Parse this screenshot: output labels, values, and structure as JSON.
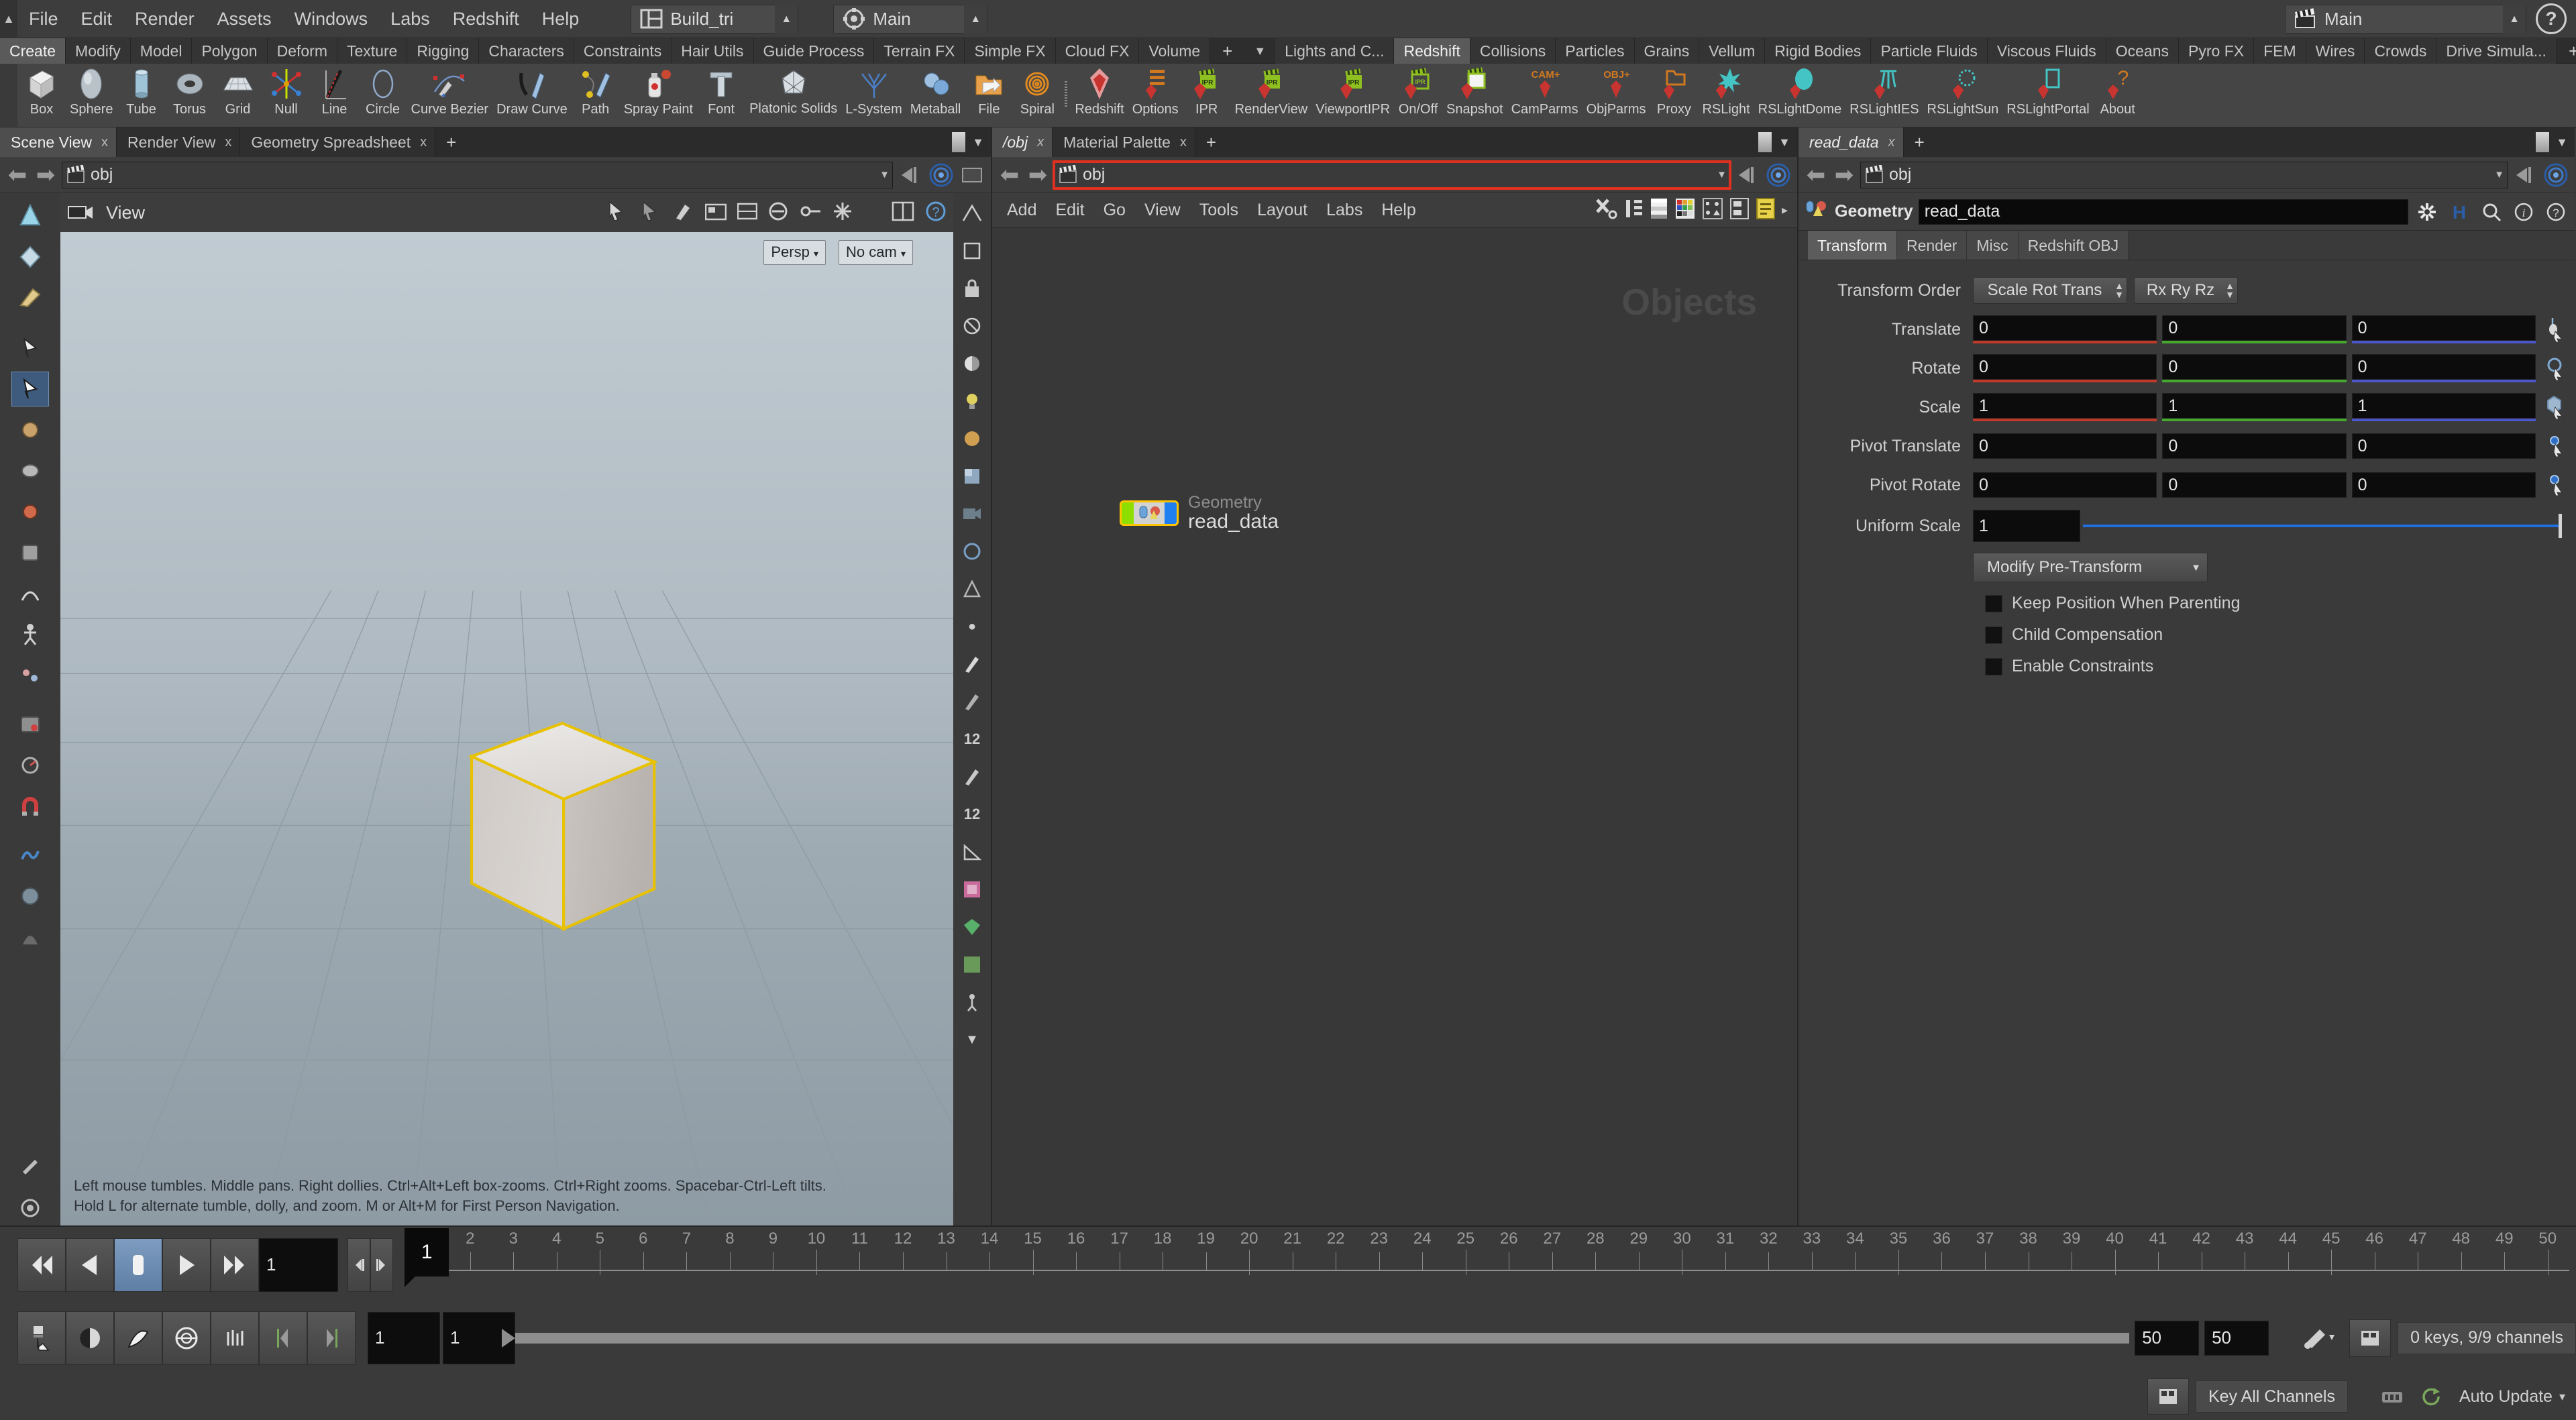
{
  "app": {
    "menus": [
      "File",
      "Edit",
      "Render",
      "Assets",
      "Windows",
      "Labs",
      "Redshift",
      "Help"
    ],
    "desktop_selector": {
      "label": "Build_tri",
      "icon": "layout-panes-icon"
    },
    "viewport_selector": {
      "label": "Main",
      "icon": "viewport-target-icon"
    },
    "takes_selector": {
      "label": "Main",
      "icon": "clapperboard-icon"
    },
    "help_icon": "help-question-icon"
  },
  "shelf": {
    "tabs_left": [
      "Create",
      "Modify",
      "Model",
      "Polygon",
      "Deform",
      "Texture",
      "Rigging",
      "Characters",
      "Constraints",
      "Hair Utils",
      "Guide Process",
      "Terrain FX",
      "Simple FX",
      "Cloud FX",
      "Volume"
    ],
    "tabs_left_active": "Create",
    "tabs_right": [
      "Lights and C...",
      "Redshift",
      "Collisions",
      "Particles",
      "Grains",
      "Vellum",
      "Rigid Bodies",
      "Particle Fluids",
      "Viscous Fluids",
      "Oceans",
      "Pyro FX",
      "FEM",
      "Wires",
      "Crowds",
      "Drive Simula..."
    ],
    "tabs_right_active": "Redshift",
    "add_tab_label": "+",
    "tools_left": [
      {
        "label": "Box",
        "icon": "box-icon"
      },
      {
        "label": "Sphere",
        "icon": "sphere-icon"
      },
      {
        "label": "Tube",
        "icon": "tube-icon"
      },
      {
        "label": "Torus",
        "icon": "torus-icon"
      },
      {
        "label": "Grid",
        "icon": "grid-icon"
      },
      {
        "label": "Null",
        "icon": "null-axis-icon"
      },
      {
        "label": "Line",
        "icon": "line-icon"
      },
      {
        "label": "Circle",
        "icon": "circle-icon"
      },
      {
        "label": "Curve Bezier",
        "icon": "curve-bezier-icon"
      },
      {
        "label": "Draw Curve",
        "icon": "draw-curve-icon"
      },
      {
        "label": "Path",
        "icon": "path-icon"
      },
      {
        "label": "Spray Paint",
        "icon": "spray-paint-icon"
      },
      {
        "label": "Font",
        "icon": "font-icon"
      },
      {
        "label": "Platonic Solids",
        "icon": "platonic-solids-icon"
      },
      {
        "label": "L-System",
        "icon": "l-system-icon"
      },
      {
        "label": "Metaball",
        "icon": "metaball-icon"
      },
      {
        "label": "File",
        "icon": "file-folder-icon"
      },
      {
        "label": "Spiral",
        "icon": "spiral-icon"
      }
    ],
    "tools_right": [
      {
        "label": "Redshift",
        "icon": "redshift-gem-icon"
      },
      {
        "label": "Options",
        "icon": "redshift-options-icon"
      },
      {
        "label": "IPR",
        "icon": "redshift-ipr-icon"
      },
      {
        "label": "RenderView",
        "icon": "redshift-renderview-icon"
      },
      {
        "label": "ViewportIPR",
        "icon": "redshift-viewportipr-icon"
      },
      {
        "label": "On/Off",
        "icon": "redshift-onoff-icon"
      },
      {
        "label": "Snapshot",
        "icon": "redshift-snapshot-icon"
      },
      {
        "label": "CamParms",
        "icon": "redshift-camparms-icon"
      },
      {
        "label": "ObjParms",
        "icon": "redshift-objparms-icon"
      },
      {
        "label": "Proxy",
        "icon": "redshift-proxy-icon"
      },
      {
        "label": "RSLight",
        "icon": "redshift-light-icon"
      },
      {
        "label": "RSLightDome",
        "icon": "redshift-lightdome-icon"
      },
      {
        "label": "RSLightIES",
        "icon": "redshift-lighties-icon"
      },
      {
        "label": "RSLightSun",
        "icon": "redshift-lightsun-icon"
      },
      {
        "label": "RSLightPortal",
        "icon": "redshift-lightportal-icon"
      },
      {
        "label": "About",
        "icon": "redshift-about-icon"
      }
    ]
  },
  "left_pane": {
    "tabs": [
      {
        "label": "Scene View",
        "active": true
      },
      {
        "label": "Render View",
        "active": false
      },
      {
        "label": "Geometry Spreadsheet",
        "active": false
      }
    ],
    "add_tab": "+",
    "path": {
      "value": "obj",
      "icon": "network-obj-icon"
    },
    "viewport_menu": {
      "label": "View",
      "icon": "view-camera-icon"
    },
    "badges": {
      "persp": "Persp",
      "camera": "No cam"
    },
    "help_line_1": "Left mouse tumbles. Middle pans. Right dollies. Ctrl+Alt+Left box-zooms. Ctrl+Right zooms. Spacebar-Ctrl-Left tilts.",
    "help_line_2": "Hold L for alternate tumble, dolly, and zoom.     M or Alt+M for First Person Navigation."
  },
  "mid_pane": {
    "tabs": [
      {
        "label": "/obj",
        "active": true,
        "italic": true
      },
      {
        "label": "Material Palette",
        "active": false,
        "italic": false
      }
    ],
    "add_tab": "+",
    "path": {
      "value": "obj",
      "icon": "network-obj-icon",
      "highlighted": true
    },
    "menus": [
      "Add",
      "Edit",
      "Go",
      "View",
      "Tools",
      "Layout",
      "Labs",
      "Help"
    ],
    "toolbar_icons": [
      "wrench-tools-icon",
      "node-list-icon",
      "grayscale-ramp-icon",
      "color-palette-icon",
      "shape-palette-icon",
      "layout-boxes-icon",
      "sticky-note-icon"
    ],
    "watermark": "Objects",
    "node": {
      "type": "Geometry",
      "name": "read_data",
      "selected": true
    }
  },
  "right_pane": {
    "tabs": [
      {
        "label": "read_data",
        "active": true,
        "italic": true
      }
    ],
    "add_tab": "+",
    "path": {
      "value": "obj",
      "icon": "network-obj-icon"
    },
    "header": {
      "node_type_label": "Geometry",
      "node_name": "read_data",
      "icons": [
        "gear-asterisk-icon",
        "houdini-h-icon",
        "search-icon",
        "info-icon",
        "help-question-icon"
      ]
    },
    "tabs_parm": [
      "Transform",
      "Render",
      "Misc",
      "Redshift OBJ"
    ],
    "tabs_parm_active": "Transform",
    "parameters": {
      "transform_order": {
        "label": "Transform Order",
        "srt": "Scale Rot Trans",
        "xyz": "Rx Ry Rz"
      },
      "translate": {
        "label": "Translate",
        "values": [
          "0",
          "0",
          "0"
        ]
      },
      "rotate": {
        "label": "Rotate",
        "values": [
          "0",
          "0",
          "0"
        ]
      },
      "scale": {
        "label": "Scale",
        "values": [
          "1",
          "1",
          "1"
        ]
      },
      "pivot_translate": {
        "label": "Pivot Translate",
        "values": [
          "0",
          "0",
          "0"
        ]
      },
      "pivot_rotate": {
        "label": "Pivot Rotate",
        "values": [
          "0",
          "0",
          "0"
        ]
      },
      "uniform_scale": {
        "label": "Uniform Scale",
        "value": "1"
      },
      "modify_pre_transform": {
        "label": "Modify Pre-Transform"
      },
      "checkboxes": [
        {
          "label": "Keep Position When Parenting",
          "checked": false
        },
        {
          "label": "Child Compensation",
          "checked": false
        },
        {
          "label": "Enable Constraints",
          "checked": false
        }
      ]
    }
  },
  "timeline": {
    "transport_icons": [
      "jump-to-start-icon",
      "step-back-icon",
      "stop-icon",
      "play-icon",
      "jump-to-end-icon"
    ],
    "current_frame": "1",
    "key_prev_icon": "key-prev-icon",
    "key_next_icon": "key-next-icon",
    "ruler_ticks": [
      "1",
      "2",
      "3",
      "4",
      "5",
      "6",
      "7",
      "8",
      "9",
      "10",
      "11",
      "12",
      "13",
      "14",
      "15",
      "16",
      "17",
      "18",
      "19",
      "20",
      "21",
      "22",
      "23",
      "24",
      "25",
      "26",
      "27",
      "28",
      "29",
      "30",
      "31",
      "32",
      "33",
      "34",
      "35",
      "36",
      "37",
      "38",
      "39",
      "40",
      "41",
      "42",
      "43",
      "44",
      "45",
      "46",
      "47",
      "48",
      "49",
      "50"
    ],
    "playhead_frame": "1",
    "bottom_icons": [
      "auto-key-icon",
      "scoped-channels-icon",
      "key-chooser-icon",
      "time-options-icon",
      "channel-list-icon",
      "set-range-start-icon",
      "set-range-end-icon"
    ],
    "range_start": "1",
    "range_playback_start": "1",
    "range_playback_end": "50",
    "range_end": "50",
    "playbar_icon": "playbar-settings-icon",
    "keys_status": "0 keys, 9/9 channels",
    "key_all_button": "Key All Channels",
    "auto_update": "Auto Update",
    "status_icons": [
      "key-status-icon",
      "key-all-icon",
      "mem-icon",
      "refresh-icon"
    ]
  }
}
